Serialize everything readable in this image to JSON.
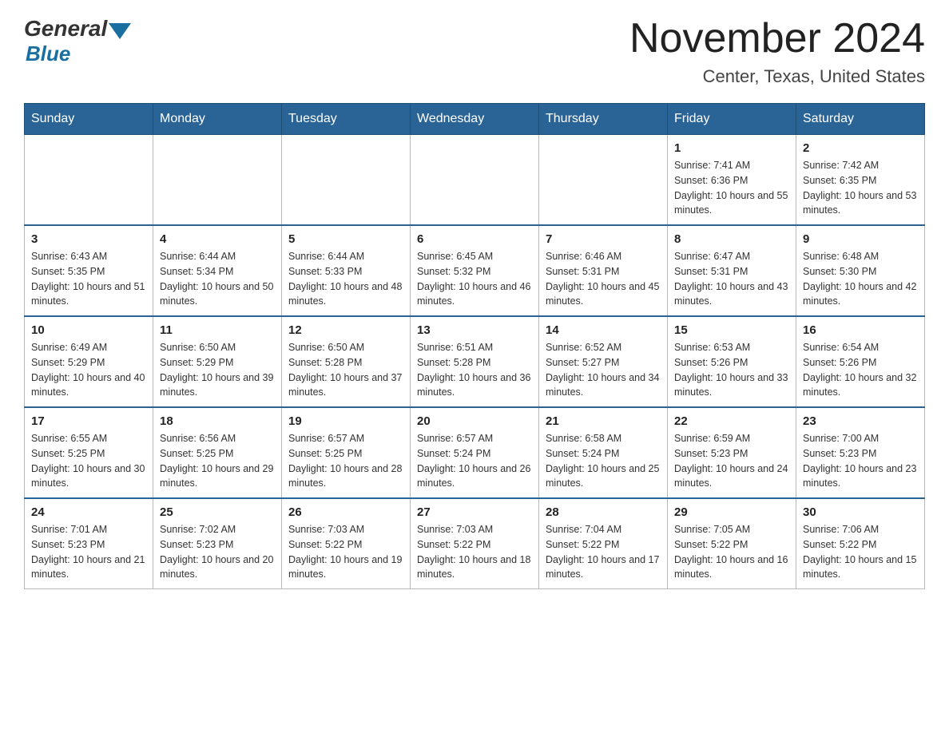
{
  "header": {
    "logo_general": "General",
    "logo_blue": "Blue",
    "title": "November 2024",
    "subtitle": "Center, Texas, United States"
  },
  "days_of_week": [
    "Sunday",
    "Monday",
    "Tuesday",
    "Wednesday",
    "Thursday",
    "Friday",
    "Saturday"
  ],
  "weeks": [
    [
      {
        "day": "",
        "sunrise": "",
        "sunset": "",
        "daylight": ""
      },
      {
        "day": "",
        "sunrise": "",
        "sunset": "",
        "daylight": ""
      },
      {
        "day": "",
        "sunrise": "",
        "sunset": "",
        "daylight": ""
      },
      {
        "day": "",
        "sunrise": "",
        "sunset": "",
        "daylight": ""
      },
      {
        "day": "",
        "sunrise": "",
        "sunset": "",
        "daylight": ""
      },
      {
        "day": "1",
        "sunrise": "Sunrise: 7:41 AM",
        "sunset": "Sunset: 6:36 PM",
        "daylight": "Daylight: 10 hours and 55 minutes."
      },
      {
        "day": "2",
        "sunrise": "Sunrise: 7:42 AM",
        "sunset": "Sunset: 6:35 PM",
        "daylight": "Daylight: 10 hours and 53 minutes."
      }
    ],
    [
      {
        "day": "3",
        "sunrise": "Sunrise: 6:43 AM",
        "sunset": "Sunset: 5:35 PM",
        "daylight": "Daylight: 10 hours and 51 minutes."
      },
      {
        "day": "4",
        "sunrise": "Sunrise: 6:44 AM",
        "sunset": "Sunset: 5:34 PM",
        "daylight": "Daylight: 10 hours and 50 minutes."
      },
      {
        "day": "5",
        "sunrise": "Sunrise: 6:44 AM",
        "sunset": "Sunset: 5:33 PM",
        "daylight": "Daylight: 10 hours and 48 minutes."
      },
      {
        "day": "6",
        "sunrise": "Sunrise: 6:45 AM",
        "sunset": "Sunset: 5:32 PM",
        "daylight": "Daylight: 10 hours and 46 minutes."
      },
      {
        "day": "7",
        "sunrise": "Sunrise: 6:46 AM",
        "sunset": "Sunset: 5:31 PM",
        "daylight": "Daylight: 10 hours and 45 minutes."
      },
      {
        "day": "8",
        "sunrise": "Sunrise: 6:47 AM",
        "sunset": "Sunset: 5:31 PM",
        "daylight": "Daylight: 10 hours and 43 minutes."
      },
      {
        "day": "9",
        "sunrise": "Sunrise: 6:48 AM",
        "sunset": "Sunset: 5:30 PM",
        "daylight": "Daylight: 10 hours and 42 minutes."
      }
    ],
    [
      {
        "day": "10",
        "sunrise": "Sunrise: 6:49 AM",
        "sunset": "Sunset: 5:29 PM",
        "daylight": "Daylight: 10 hours and 40 minutes."
      },
      {
        "day": "11",
        "sunrise": "Sunrise: 6:50 AM",
        "sunset": "Sunset: 5:29 PM",
        "daylight": "Daylight: 10 hours and 39 minutes."
      },
      {
        "day": "12",
        "sunrise": "Sunrise: 6:50 AM",
        "sunset": "Sunset: 5:28 PM",
        "daylight": "Daylight: 10 hours and 37 minutes."
      },
      {
        "day": "13",
        "sunrise": "Sunrise: 6:51 AM",
        "sunset": "Sunset: 5:28 PM",
        "daylight": "Daylight: 10 hours and 36 minutes."
      },
      {
        "day": "14",
        "sunrise": "Sunrise: 6:52 AM",
        "sunset": "Sunset: 5:27 PM",
        "daylight": "Daylight: 10 hours and 34 minutes."
      },
      {
        "day": "15",
        "sunrise": "Sunrise: 6:53 AM",
        "sunset": "Sunset: 5:26 PM",
        "daylight": "Daylight: 10 hours and 33 minutes."
      },
      {
        "day": "16",
        "sunrise": "Sunrise: 6:54 AM",
        "sunset": "Sunset: 5:26 PM",
        "daylight": "Daylight: 10 hours and 32 minutes."
      }
    ],
    [
      {
        "day": "17",
        "sunrise": "Sunrise: 6:55 AM",
        "sunset": "Sunset: 5:25 PM",
        "daylight": "Daylight: 10 hours and 30 minutes."
      },
      {
        "day": "18",
        "sunrise": "Sunrise: 6:56 AM",
        "sunset": "Sunset: 5:25 PM",
        "daylight": "Daylight: 10 hours and 29 minutes."
      },
      {
        "day": "19",
        "sunrise": "Sunrise: 6:57 AM",
        "sunset": "Sunset: 5:25 PM",
        "daylight": "Daylight: 10 hours and 28 minutes."
      },
      {
        "day": "20",
        "sunrise": "Sunrise: 6:57 AM",
        "sunset": "Sunset: 5:24 PM",
        "daylight": "Daylight: 10 hours and 26 minutes."
      },
      {
        "day": "21",
        "sunrise": "Sunrise: 6:58 AM",
        "sunset": "Sunset: 5:24 PM",
        "daylight": "Daylight: 10 hours and 25 minutes."
      },
      {
        "day": "22",
        "sunrise": "Sunrise: 6:59 AM",
        "sunset": "Sunset: 5:23 PM",
        "daylight": "Daylight: 10 hours and 24 minutes."
      },
      {
        "day": "23",
        "sunrise": "Sunrise: 7:00 AM",
        "sunset": "Sunset: 5:23 PM",
        "daylight": "Daylight: 10 hours and 23 minutes."
      }
    ],
    [
      {
        "day": "24",
        "sunrise": "Sunrise: 7:01 AM",
        "sunset": "Sunset: 5:23 PM",
        "daylight": "Daylight: 10 hours and 21 minutes."
      },
      {
        "day": "25",
        "sunrise": "Sunrise: 7:02 AM",
        "sunset": "Sunset: 5:23 PM",
        "daylight": "Daylight: 10 hours and 20 minutes."
      },
      {
        "day": "26",
        "sunrise": "Sunrise: 7:03 AM",
        "sunset": "Sunset: 5:22 PM",
        "daylight": "Daylight: 10 hours and 19 minutes."
      },
      {
        "day": "27",
        "sunrise": "Sunrise: 7:03 AM",
        "sunset": "Sunset: 5:22 PM",
        "daylight": "Daylight: 10 hours and 18 minutes."
      },
      {
        "day": "28",
        "sunrise": "Sunrise: 7:04 AM",
        "sunset": "Sunset: 5:22 PM",
        "daylight": "Daylight: 10 hours and 17 minutes."
      },
      {
        "day": "29",
        "sunrise": "Sunrise: 7:05 AM",
        "sunset": "Sunset: 5:22 PM",
        "daylight": "Daylight: 10 hours and 16 minutes."
      },
      {
        "day": "30",
        "sunrise": "Sunrise: 7:06 AM",
        "sunset": "Sunset: 5:22 PM",
        "daylight": "Daylight: 10 hours and 15 minutes."
      }
    ]
  ]
}
